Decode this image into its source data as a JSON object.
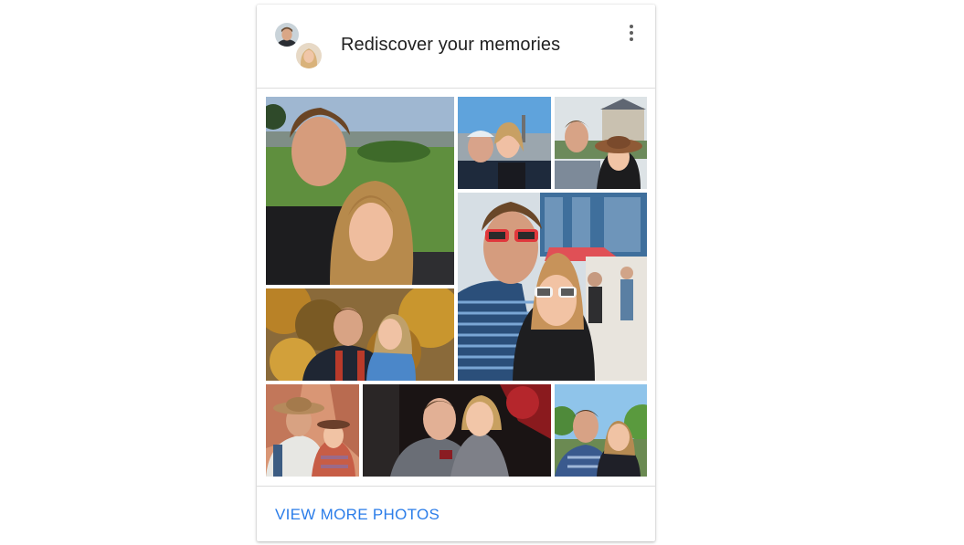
{
  "card": {
    "title": "Rediscover your memories",
    "footer_action": "VIEW MORE PHOTOS"
  },
  "colors": {
    "accent_link": "#2b7de9",
    "title_text": "#212121",
    "divider": "#dcdcdc"
  },
  "avatars": [
    {
      "name": "avatar-man"
    },
    {
      "name": "avatar-woman"
    }
  ],
  "photos": [
    {
      "name": "photo-park-selfie",
      "scene": "park"
    },
    {
      "name": "photo-city-overlook",
      "scene": "city"
    },
    {
      "name": "photo-chateau-hat",
      "scene": "chateau"
    },
    {
      "name": "photo-sunglasses-festival",
      "scene": "festival"
    },
    {
      "name": "photo-autumn-trees",
      "scene": "autumn"
    },
    {
      "name": "photo-canyon-hiking",
      "scene": "canyon"
    },
    {
      "name": "photo-night-hug",
      "scene": "night"
    },
    {
      "name": "photo-trees-daytime",
      "scene": "trees"
    }
  ]
}
